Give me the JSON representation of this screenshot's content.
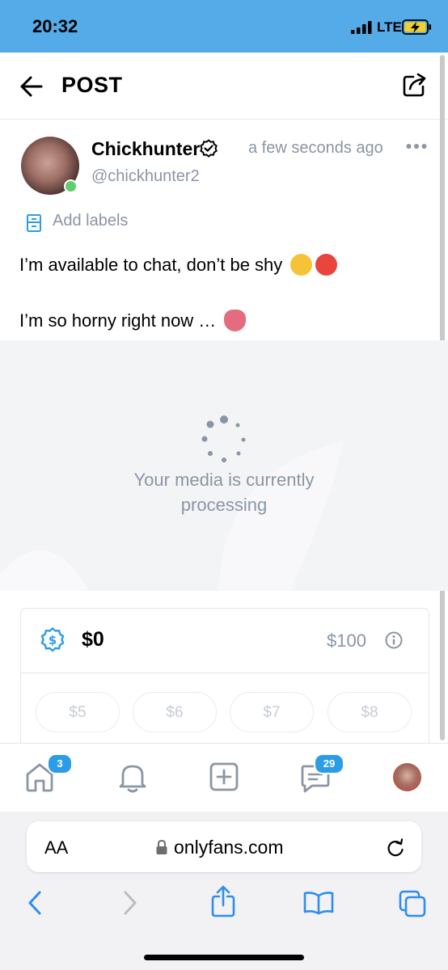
{
  "status_bar": {
    "time": "20:32",
    "network": "LTE"
  },
  "header": {
    "title": "POST"
  },
  "post": {
    "author_name": "Chickhunter",
    "handle": "@chickhunter2",
    "timestamp": "a few seconds ago",
    "labels_action": "Add labels",
    "text_line_1": "I’m available to chat, don’t be shy",
    "text_line_2": "I’m so horny right now …",
    "emojis": [
      "kissing-face-emoji",
      "hot-face-emoji",
      "tongue-emoji"
    ]
  },
  "media": {
    "processing_line_1": "Your media is currently",
    "processing_line_2": "processing"
  },
  "price": {
    "value": "$0",
    "max": "$100",
    "presets": [
      "$5",
      "$6",
      "$7",
      "$8"
    ]
  },
  "bottom_nav": {
    "home_badge": "3",
    "messages_badge": "29"
  },
  "browser": {
    "text_size_label": "AA",
    "url": "onlyfans.com"
  },
  "colors": {
    "status_bar": "#55abe8",
    "accent": "#00aff0",
    "muted": "#8a96a3",
    "online": "#5fce6d"
  }
}
